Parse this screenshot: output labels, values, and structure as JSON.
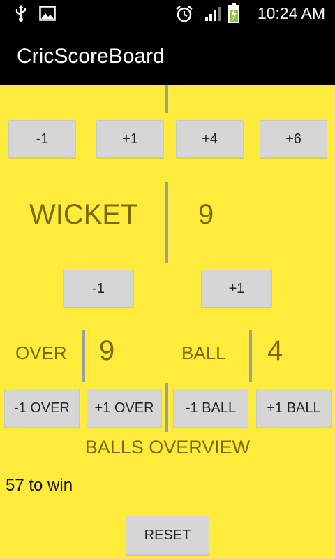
{
  "status_bar": {
    "time": "10:24 AM",
    "icons": [
      "usb-icon",
      "image-icon",
      "alarm-icon",
      "signal-icon",
      "battery-charging-icon"
    ]
  },
  "app": {
    "title": "CricScoreBoard"
  },
  "runs_buttons": [
    "-1",
    "+1",
    "+4",
    "+6"
  ],
  "wicket": {
    "label": "WICKET",
    "value": "9",
    "minus_label": "-1",
    "plus_label": "+1"
  },
  "over": {
    "label": "OVER",
    "value": "9"
  },
  "ball": {
    "label": "BALL",
    "value": "4"
  },
  "over_ball_buttons": [
    "-1 OVER",
    "+1 OVER",
    "-1 BALL",
    "+1 BALL"
  ],
  "balls_overview_label": "BALLS OVERVIEW",
  "target_text": "57 to win",
  "reset_label": "RESET",
  "colors": {
    "background": "#ffeb3b",
    "label_text": "#7a6b00",
    "button": "#d6d6d6",
    "divider": "#9e9e9e"
  }
}
